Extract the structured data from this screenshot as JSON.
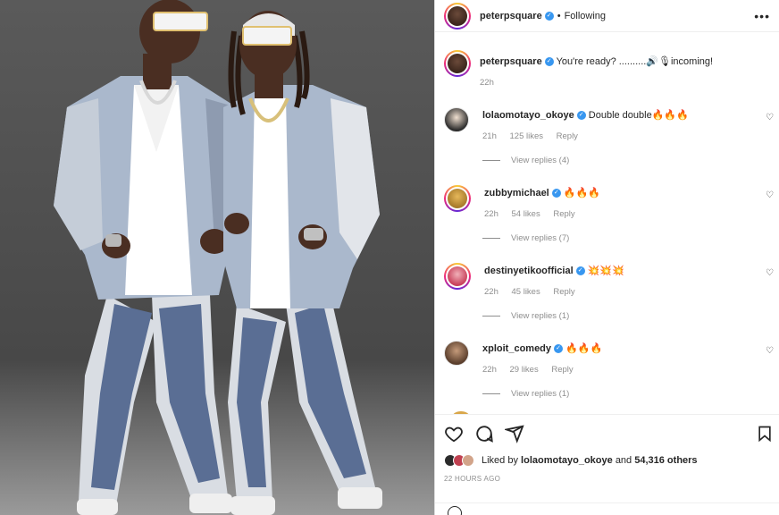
{
  "colors": {
    "accent": "#3897f0",
    "muted": "#8e8e8e",
    "text": "#262626",
    "border": "#dbdbdb"
  },
  "photo": {
    "description_icon": "photo"
  },
  "header": {
    "username": "peterpsquare",
    "separator": "•",
    "follow_status": "Following",
    "more_icon": "more-horizontal-icon"
  },
  "caption": {
    "username": "peterpsquare",
    "text": "You're ready? ..........🔊🎙incoming!",
    "time": "22h"
  },
  "comments": [
    {
      "username": "lolaomotayo_okoye",
      "text": "Double double🔥🔥🔥",
      "time": "21h",
      "likes": "125 likes",
      "reply": "Reply",
      "view_replies": "View replies (4)",
      "avatar_color": "#2b2b2b"
    },
    {
      "username": "zubbymichael",
      "text": "🔥🔥🔥",
      "time": "22h",
      "likes": "54 likes",
      "reply": "Reply",
      "view_replies": "View replies (7)",
      "avatar_color": "#c9a23a"
    },
    {
      "username": "destinyetikoofficial",
      "text": "💥💥💥",
      "time": "22h",
      "likes": "45 likes",
      "reply": "Reply",
      "view_replies": "View replies (1)",
      "avatar_color": "#d45a7a"
    },
    {
      "username": "xploit_comedy",
      "text": "🔥🔥🔥",
      "time": "22h",
      "likes": "29 likes",
      "reply": "Reply",
      "view_replies": "View replies (1)",
      "avatar_color": "#7a5a44"
    }
  ],
  "actions": {
    "like_icon": "heart-icon",
    "comment_icon": "comment-icon",
    "share_icon": "send-icon",
    "save_icon": "bookmark-icon"
  },
  "likes": {
    "prefix": "Liked by",
    "user": "lolaomotayo_okoye",
    "middle": "and",
    "others": "54,316 others"
  },
  "timestamp": "22 HOURS AGO"
}
